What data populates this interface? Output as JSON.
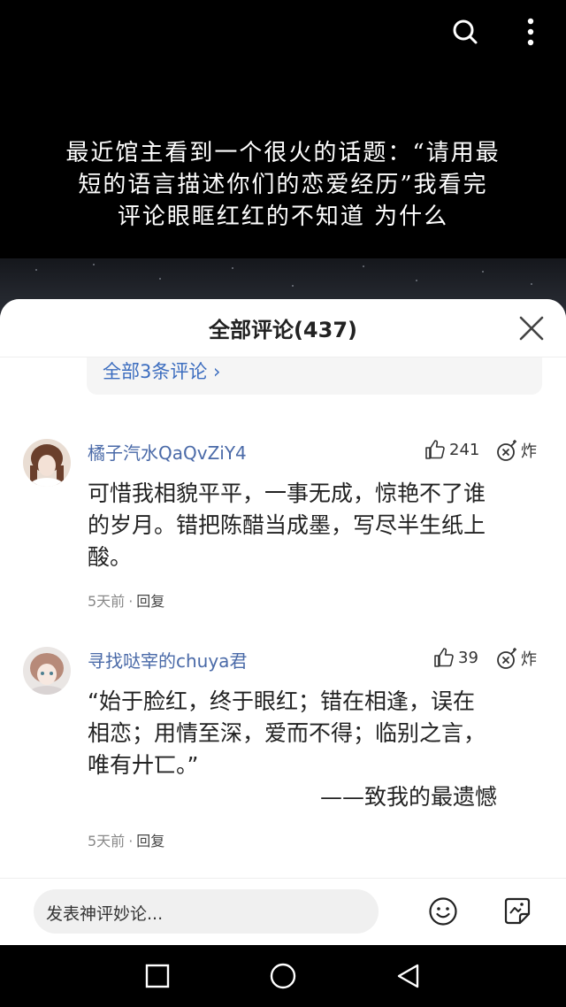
{
  "video": {
    "caption": "最近馆主看到一个很火的话题：“请用最\n短的语言描述你们的恋爱经历”我看完\n评论眼眶红红的不知道 为什么",
    "icons": [
      "search-icon",
      "more-vertical-icon"
    ]
  },
  "sheet": {
    "title": "全部评论(437)",
    "reply_summary": "全部3条评论 ›"
  },
  "comments": [
    {
      "username": "橘子汽水QaQvZiY4",
      "likes": "241",
      "bomb_label": "炸",
      "text": "可惜我相貌平平，一事无成，惊艳不了谁\n的岁月。错把陈醋当成墨，写尽半生纸上\n酸。",
      "time": "5天前",
      "separator": "·",
      "reply": "回复"
    },
    {
      "username": "寻找哒宰的chuya君",
      "likes": "39",
      "bomb_label": "炸",
      "text": "“始于脸红，终于眼红；错在相逢，误在\n相恋；用情至深，爱而不得；临别之言，\n唯有廾匸。”",
      "signature": "——致我的最遗憾",
      "time": "5天前",
      "separator": "·",
      "reply": "回复"
    }
  ],
  "input": {
    "placeholder": "发表神评妙论..."
  },
  "colors": {
    "link": "#3c6dbf",
    "username": "#4a6aa8",
    "sheet_bg": "#ffffff"
  }
}
